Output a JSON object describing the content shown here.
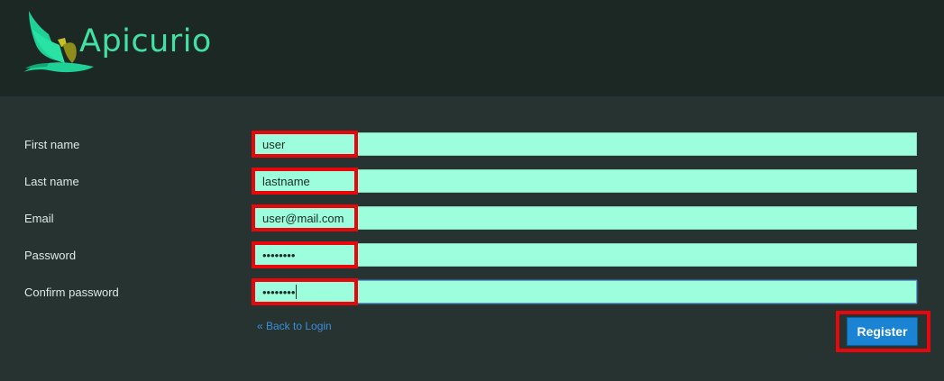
{
  "brand": {
    "name": "Apicurio",
    "logo_icon": "bird-logo-icon",
    "color": "#43e0a3"
  },
  "form": {
    "fields": [
      {
        "label": "First name",
        "value": "user",
        "type": "text"
      },
      {
        "label": "Last name",
        "value": "lastname",
        "type": "text"
      },
      {
        "label": "Email",
        "value": "user@mail.com",
        "type": "text"
      },
      {
        "label": "Password",
        "value": "••••••••",
        "type": "password"
      },
      {
        "label": "Confirm password",
        "value": "••••••••",
        "type": "password",
        "focused": true
      }
    ],
    "back_link": "« Back to Login",
    "submit_label": "Register"
  },
  "colors": {
    "header_bg": "#1b2824",
    "page_bg": "#263330",
    "field_bg": "#9dfedd",
    "highlight": "#e8070b",
    "button_bg": "#1b83d4",
    "link": "#3b8fd6"
  }
}
